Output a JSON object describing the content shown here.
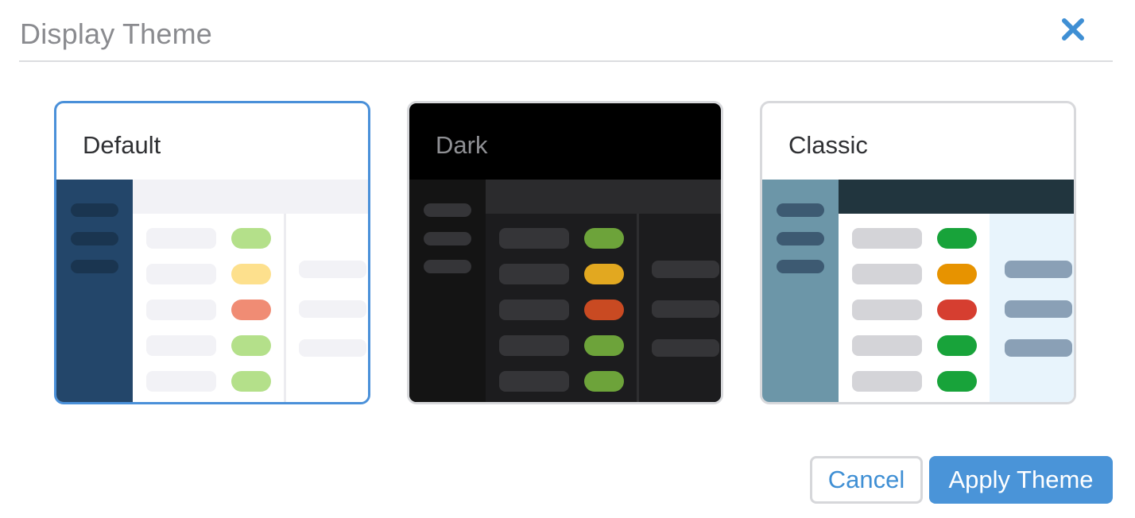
{
  "dialog": {
    "title": "Display Theme",
    "close_icon": "close-x-icon",
    "accent_color": "#4a90d9"
  },
  "themes": [
    {
      "name": "Default",
      "selected": true,
      "colors": {
        "header_bg": "#ffffff",
        "name_color": "#2f3033",
        "sidebar": "#23466a",
        "sidebar_pill": "#1a3550",
        "topbar": "#f2f2f6",
        "main": "#ffffff",
        "text_pill": "#f2f2f6",
        "right": "#ffffff",
        "right_pill": "#f2f2f6",
        "divider": "#ececf0",
        "status": [
          "#b4e08a",
          "#fde08d",
          "#f08c74",
          "#b4e08a",
          "#b4e08a"
        ]
      }
    },
    {
      "name": "Dark",
      "selected": false,
      "colors": {
        "header_bg": "#000000",
        "name_color": "#8f9094",
        "sidebar": "#141414",
        "sidebar_pill": "#353538",
        "topbar": "#2b2b2d",
        "main": "#1c1c1e",
        "text_pill": "#353538",
        "right": "#1c1c1e",
        "right_pill": "#353538",
        "divider": "#2e2e30",
        "status": [
          "#6da33a",
          "#e2a820",
          "#c94a22",
          "#6da33a",
          "#6da33a"
        ]
      }
    },
    {
      "name": "Classic",
      "selected": false,
      "colors": {
        "header_bg": "#ffffff",
        "name_color": "#2f3033",
        "sidebar": "#6c96a8",
        "sidebar_pill": "#3d5a72",
        "topbar": "#21353e",
        "main": "#ffffff",
        "text_pill": "#d4d4d8",
        "right": "#e8f4fc",
        "right_pill": "#8aa0b6",
        "divider": "#e8f4fc",
        "status": [
          "#18a33a",
          "#e79300",
          "#d63e30",
          "#18a33a",
          "#18a33a"
        ]
      }
    }
  ],
  "footer": {
    "cancel_label": "Cancel",
    "apply_label": "Apply Theme"
  }
}
